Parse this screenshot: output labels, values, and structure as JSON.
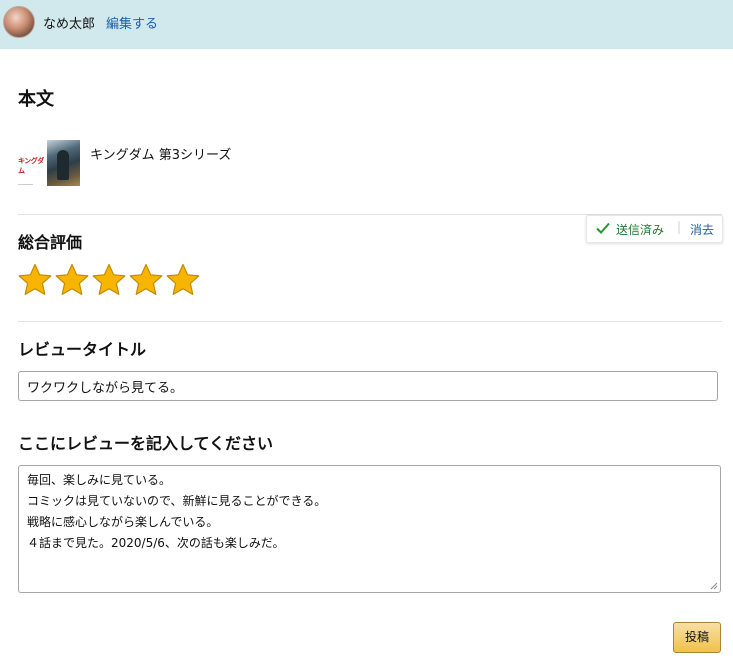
{
  "header": {
    "username": "なめ太郎",
    "edit_link": "編集する"
  },
  "main": {
    "heading": "本文"
  },
  "product": {
    "logo_text": "キングダム",
    "title": "キングダム 第3シリーズ"
  },
  "rating": {
    "heading": "総合評価",
    "value": 5,
    "max": 5,
    "status_sent": "送信済み",
    "status_separator": "|",
    "clear_label": "消去",
    "star_color": "#f7b500"
  },
  "review_title": {
    "heading": "レビュータイトル",
    "value": "ワクワクしながら見てる。"
  },
  "review_body": {
    "heading": "ここにレビューを記入してください",
    "lines": [
      "毎回、楽しみに見ている。",
      "コミックは見ていないので、新鮮に見ることができる。",
      "戦略に感心しながら楽しんでいる。",
      "４話まで見た。2020/5/6、次の話も楽しみだ。"
    ]
  },
  "submit": {
    "label": "投稿"
  }
}
